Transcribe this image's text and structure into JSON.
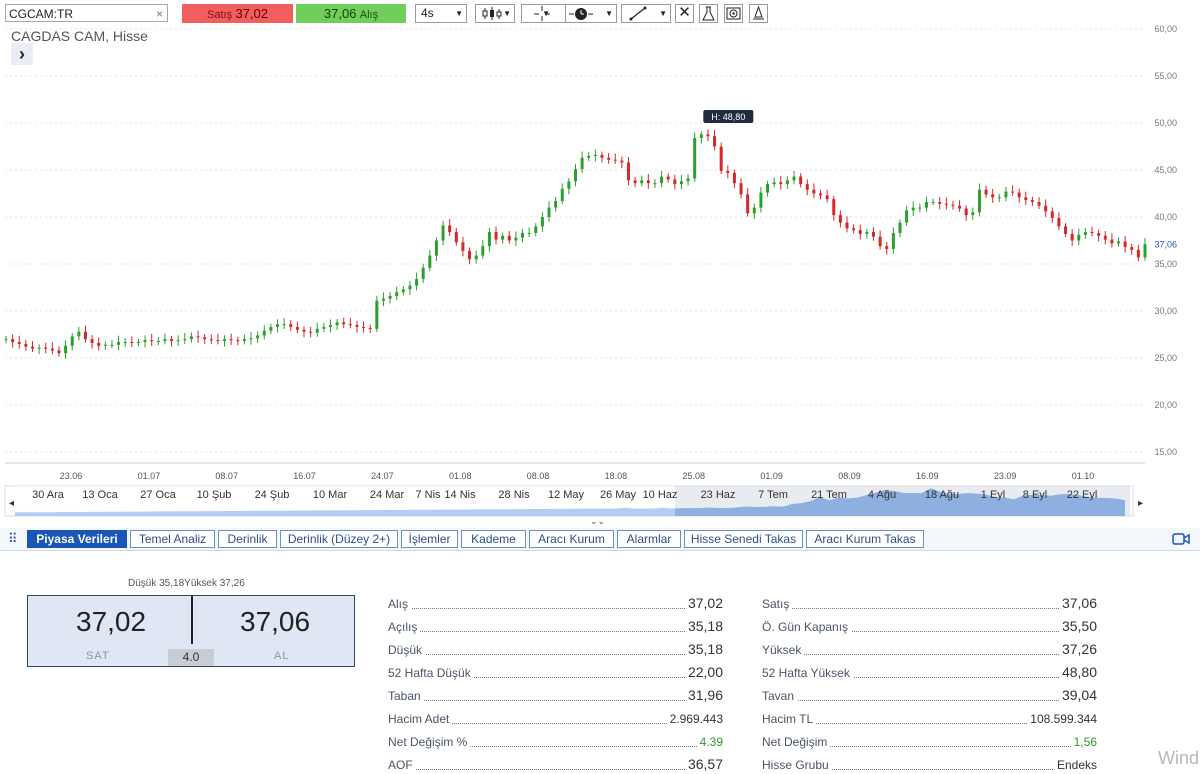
{
  "toolbar": {
    "symbol_input": "CGCAM:TR",
    "clear_icon": "close-icon",
    "sell_label": "Satış",
    "sell_value": "37,02",
    "buy_value": "37,06",
    "buy_label": "Alış",
    "interval": "4s",
    "colors": {
      "sell": "#f25e5e",
      "buy": "#6fcf5a"
    },
    "icons": [
      "candlestick-icon",
      "crosshair-icon",
      "clock-icon",
      "line-draw-icon",
      "close-icon",
      "flask-icon",
      "target-icon",
      "bell-icon"
    ]
  },
  "symbol_title": "CAGDAS CAM, Hisse",
  "chart_data": {
    "type": "candlestick",
    "ylim": [
      15,
      60
    ],
    "y_ticks": [
      "60,00",
      "55,00",
      "50,00",
      "45,00",
      "40,00",
      "35,00",
      "30,00",
      "25,00",
      "20,00",
      "15,00"
    ],
    "last_price_label": "37,06",
    "high_marker": "H: 48,80",
    "x_ticks": [
      "23.06",
      "01.07",
      "08.07",
      "16.07",
      "24.07",
      "01.08",
      "08.08",
      "18.08",
      "25.08",
      "01.09",
      "08.09",
      "16.09",
      "23.09",
      "01.10"
    ],
    "close_series": [
      27.0,
      26.7,
      26.5,
      26.2,
      26.0,
      26.1,
      26.0,
      25.8,
      25.5,
      26.3,
      27.3,
      27.8,
      27.0,
      26.6,
      26.3,
      26.4,
      26.4,
      26.7,
      26.7,
      26.6,
      26.7,
      26.9,
      26.8,
      26.8,
      27.0,
      26.8,
      26.9,
      27.0,
      27.3,
      27.2,
      27.0,
      26.9,
      26.8,
      27.0,
      26.9,
      26.8,
      27.0,
      27.1,
      27.4,
      27.9,
      28.3,
      28.6,
      28.6,
      28.3,
      28.0,
      27.8,
      27.7,
      28.1,
      28.3,
      28.5,
      28.8,
      28.6,
      28.5,
      28.3,
      28.2,
      28.1,
      31.1,
      31.3,
      31.6,
      32.0,
      32.3,
      32.7,
      33.4,
      34.6,
      35.9,
      37.5,
      39.1,
      38.4,
      37.3,
      36.4,
      35.5,
      35.9,
      36.9,
      38.4,
      37.6,
      38.0,
      37.5,
      37.8,
      38.3,
      38.3,
      39.0,
      40.0,
      41.0,
      41.7,
      43.0,
      43.8,
      45.1,
      46.3,
      46.5,
      46.6,
      46.3,
      46.1,
      46.0,
      45.8,
      43.9,
      43.6,
      43.9,
      43.6,
      43.6,
      44.3,
      44.0,
      43.5,
      43.8,
      44.1,
      48.4,
      48.8,
      48.6,
      47.5,
      44.9,
      44.7,
      43.6,
      42.4,
      40.4,
      41.0,
      42.6,
      43.5,
      43.7,
      43.5,
      43.9,
      44.3,
      43.5,
      42.9,
      42.5,
      42.3,
      41.9,
      40.2,
      39.4,
      38.8,
      38.6,
      38.2,
      38.4,
      37.9,
      36.9,
      36.6,
      38.3,
      39.4,
      40.7,
      41.0,
      41.0,
      41.6,
      41.6,
      41.4,
      41.3,
      41.2,
      40.9,
      40.2,
      40.5,
      42.9,
      42.4,
      42.1,
      42.1,
      42.7,
      42.6,
      42.1,
      41.8,
      41.6,
      41.2,
      40.6,
      39.9,
      39.0,
      38.2,
      37.5,
      38.1,
      38.4,
      38.3,
      38.0,
      37.6,
      37.2,
      37.4,
      36.8,
      36.5,
      35.7,
      37.1
    ],
    "navigator_labels": [
      "30 Ara",
      "13 Oca",
      "27 Oca",
      "10 Şub",
      "24 Şub",
      "10 Mar",
      "24 Mar",
      "7 Nis",
      "14 Nis",
      "28 Nis",
      "12 May",
      "26 May",
      "10 Haz",
      "23 Haz",
      "7 Tem",
      "21 Tem",
      "4 Ağu",
      "18 Ağu",
      "1 Eyl",
      "8 Eyl",
      "22 Eyl"
    ],
    "colors": {
      "up": "#2ca02c",
      "down": "#d62728"
    }
  },
  "tabs": [
    "Piyasa Verileri",
    "Temel Analiz",
    "Derinlik",
    "Derinlik (Düzey 2+)",
    "İşlemler",
    "Kademe",
    "Aracı Kurum",
    "Alarmlar",
    "Hisse Senedi Takas",
    "Aracı Kurum Takas"
  ],
  "market": {
    "range_low_label": "Düşük 35,18",
    "range_high_label": "Yüksek 37,26",
    "bid": "37,02",
    "bid_label": "SAT",
    "ask": "37,06",
    "ask_label": "AL",
    "spread": "4.0",
    "left_rows": [
      {
        "k": "Alış",
        "v": "37,02"
      },
      {
        "k": "Açılış",
        "v": "35,18"
      },
      {
        "k": "Düşük",
        "v": "35,18"
      },
      {
        "k": "52 Hafta Düşük",
        "v": "22,00"
      },
      {
        "k": "Taban",
        "v": "31,96"
      },
      {
        "k": "Hacim Adet",
        "v": "2.969.443"
      },
      {
        "k": "Net Değişim %",
        "v": "4.39"
      },
      {
        "k": "AOF",
        "v": "36,57"
      }
    ],
    "right_rows": [
      {
        "k": "Satış",
        "v": "37,06"
      },
      {
        "k": "Ö. Gün Kapanış",
        "v": "35,50"
      },
      {
        "k": "Yüksek",
        "v": "37,26"
      },
      {
        "k": "52 Hafta Yüksek",
        "v": "48,80"
      },
      {
        "k": "Tavan",
        "v": "39,04"
      },
      {
        "k": "Hacim TL",
        "v": "108.599.344"
      },
      {
        "k": "Net Değişim",
        "v": "1,56"
      },
      {
        "k": "Hisse Grubu",
        "v": "Endeks"
      }
    ]
  },
  "watermark": "Wind"
}
